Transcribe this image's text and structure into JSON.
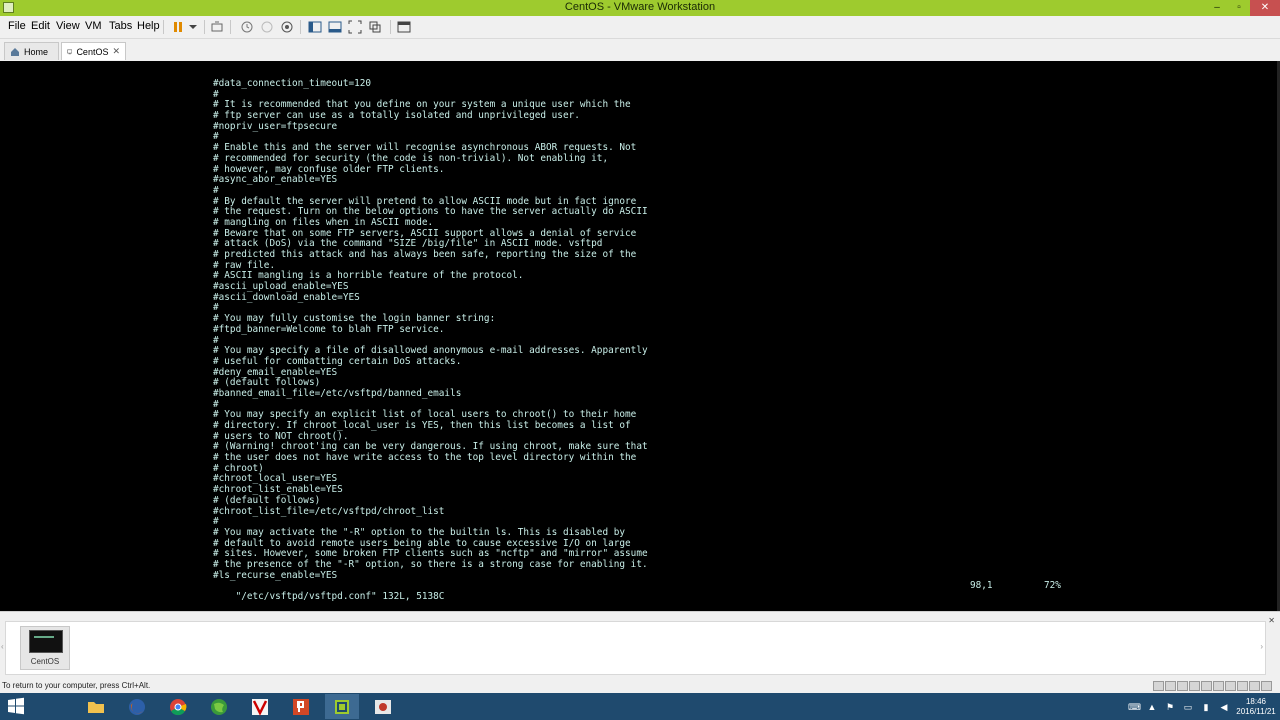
{
  "window": {
    "title": "CentOS  - VMware Workstation",
    "controls": [
      "–",
      "▫",
      "✕"
    ]
  },
  "menu": [
    "File",
    "Edit",
    "View",
    "VM",
    "Tabs",
    "Help"
  ],
  "tabs": [
    {
      "label": "Home",
      "active": false
    },
    {
      "label": "CentOS",
      "active": true
    }
  ],
  "terminal": {
    "lines": [
      "#data_connection_timeout=120",
      "#",
      "# It is recommended that you define on your system a unique user which the",
      "# ftp server can use as a totally isolated and unprivileged user.",
      "#nopriv_user=ftpsecure",
      "#",
      "# Enable this and the server will recognise asynchronous ABOR requests. Not",
      "# recommended for security (the code is non-trivial). Not enabling it,",
      "# however, may confuse older FTP clients.",
      "#async_abor_enable=YES",
      "#",
      "# By default the server will pretend to allow ASCII mode but in fact ignore",
      "# the request. Turn on the below options to have the server actually do ASCII",
      "# mangling on files when in ASCII mode.",
      "# Beware that on some FTP servers, ASCII support allows a denial of service",
      "# attack (DoS) via the command \"SIZE /big/file\" in ASCII mode. vsftpd",
      "# predicted this attack and has always been safe, reporting the size of the",
      "# raw file.",
      "# ASCII mangling is a horrible feature of the protocol.",
      "#ascii_upload_enable=YES",
      "#ascii_download_enable=YES",
      "#",
      "# You may fully customise the login banner string:",
      "#ftpd_banner=Welcome to blah FTP service.",
      "#",
      "# You may specify a file of disallowed anonymous e-mail addresses. Apparently",
      "# useful for combatting certain DoS attacks.",
      "#deny_email_enable=YES",
      "# (default follows)",
      "#banned_email_file=/etc/vsftpd/banned_emails",
      "#",
      "# You may specify an explicit list of local users to chroot() to their home",
      "# directory. If chroot_local_user is YES, then this list becomes a list of",
      "# users to NOT chroot().",
      "# (Warning! chroot'ing can be very dangerous. If using chroot, make sure that",
      "# the user does not have write access to the top level directory within the",
      "# chroot)",
      "#chroot_local_user=YES",
      "#chroot_list_enable=YES",
      "# (default follows)",
      "#chroot_list_file=/etc/vsftpd/chroot_list",
      "#",
      "# You may activate the \"-R\" option to the builtin ls. This is disabled by",
      "# default to avoid remote users being able to cause excessive I/O on large",
      "# sites. However, some broken FTP clients such as \"ncftp\" and \"mirror\" assume",
      "# the presence of the \"-R\" option, so there is a strong case for enabling it.",
      "#ls_recurse_enable=YES"
    ],
    "status_file": "\"/etc/vsftpd/vsftpd.conf\" 132L, 5138C",
    "status_pos": "98,1",
    "status_pct": "72%"
  },
  "thumbnail": {
    "label": "CentOS"
  },
  "statusbar": {
    "message": "To return to your computer, press Ctrl+Alt."
  },
  "clock": {
    "time": "18:46",
    "date": "2016/11/21"
  },
  "colors": {
    "titlebar": "#9ecb2e",
    "console_bg": "#000000",
    "console_text": "#c8eee8",
    "taskbar": "#1f4a6e"
  }
}
